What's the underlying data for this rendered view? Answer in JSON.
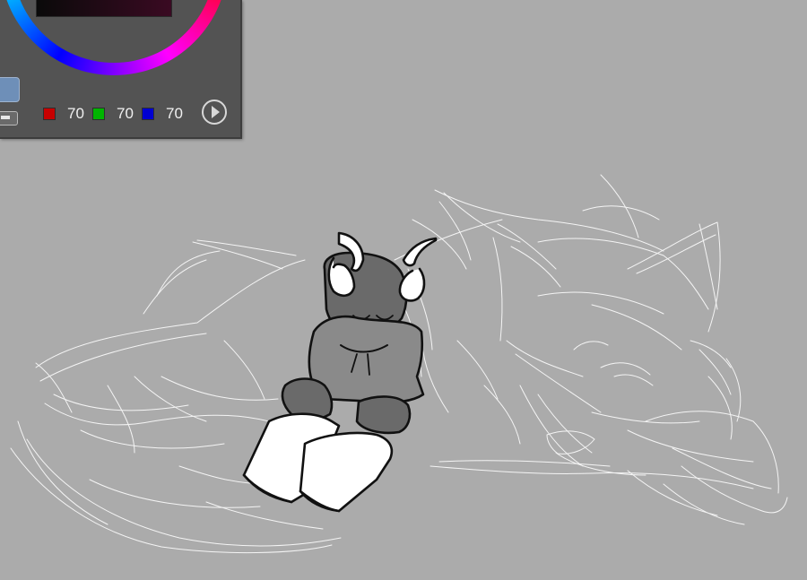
{
  "color_panel": {
    "red_value": "70",
    "green_value": "70",
    "blue_value": "70",
    "colors": {
      "red_swatch": "#c80000",
      "green_swatch": "#00b400",
      "blue_swatch": "#0000d2",
      "panel": "#535353",
      "canvas": "#ababab"
    },
    "icons": [
      "color-wheel",
      "swatch",
      "swap-icon",
      "play-icon"
    ]
  }
}
